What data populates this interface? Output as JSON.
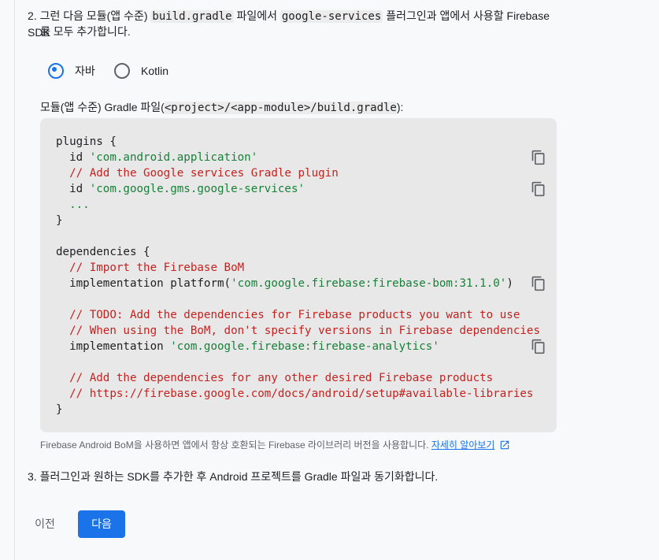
{
  "step2": {
    "number": "2.",
    "part1": "그런 다음 모듈(앱 수준)",
    "code1": "build.gradle",
    "part2": "파일에서",
    "code2": "google-services",
    "part3": "플러그인과 앱에서 사용할 Firebase SDK",
    "line2": "를 모두 추가합니다."
  },
  "language_options": [
    {
      "label": "자바",
      "checked": true
    },
    {
      "label": "Kotlin",
      "checked": false
    }
  ],
  "file_label": {
    "prefix": "모듈(앱 수준) Gradle 파일(",
    "path": "<project>/<app-module>/build.gradle",
    "suffix": "):"
  },
  "code": {
    "l1_kw": "plugins ",
    "l1_brace": "{",
    "l2_kw": "  id ",
    "l2_str": "'com.android.application'",
    "l3_cmt": "  // Add the Google services Gradle plugin",
    "l4_kw": "  id ",
    "l4_str": "'com.google.gms.google-services'",
    "l5_dots": "  ...",
    "l6_brace": "}",
    "l8_kw": "dependencies ",
    "l8_brace": "{",
    "l9_cmt": "  // Import the Firebase BoM",
    "l10_kw": "  implementation platform(",
    "l10_str": "'com.google.firebase:firebase-bom:31.1.0'",
    "l10_end": ")",
    "l12_cmt": "  // TODO: Add the dependencies for Firebase products you want to use",
    "l13_cmt": "  // When using the BoM, don't specify versions in Firebase dependencies",
    "l14_kw": "  implementation ",
    "l14_str": "'com.google.firebase:firebase-analytics'",
    "l16_cmt": "  // Add the dependencies for any other desired Firebase products",
    "l17_cmt": "  // https://firebase.google.com/docs/android/setup#available-libraries",
    "l18_brace": "}"
  },
  "bom_note": {
    "text": "Firebase Android BoM을 사용하면 앱에서 항상 호환되는 Firebase 라이브러리 버전을 사용합니다. ",
    "link": "자세히 알아보기"
  },
  "step3": {
    "number": "3.",
    "text": "플러그인과 원하는 SDK를 추가한 후 Android 프로젝트를 Gradle 파일과 동기화합니다."
  },
  "buttons": {
    "back": "이전",
    "next": "다음"
  },
  "colors": {
    "accent": "#1a73e8",
    "string": "#188038",
    "comment": "#c5221f",
    "code_bg": "#e8e8e8"
  }
}
